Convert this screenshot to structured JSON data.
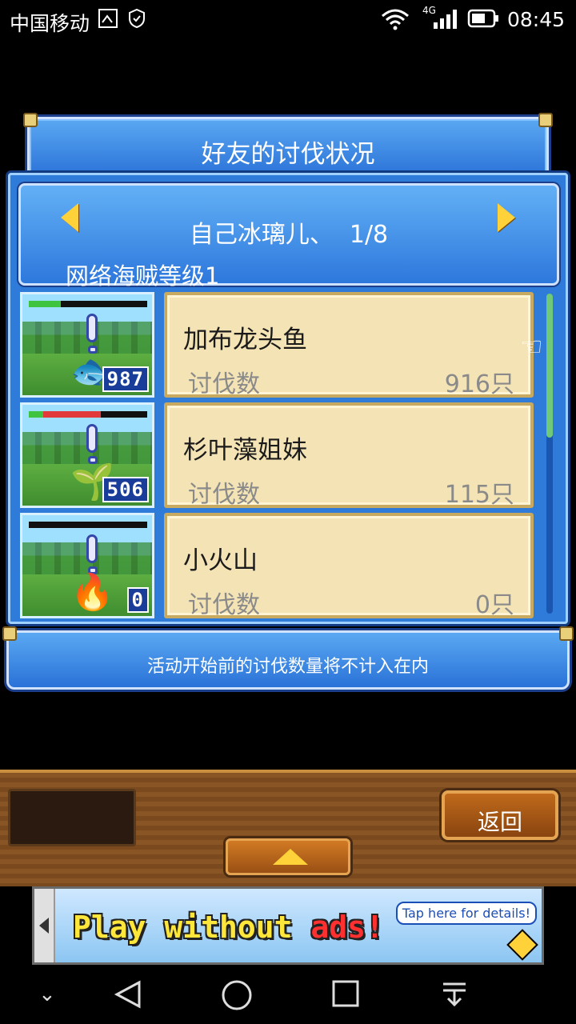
{
  "status_bar": {
    "carrier": "中国移动",
    "network": "4G",
    "time": "08:45"
  },
  "dialog": {
    "title": "好友的讨伐状况",
    "player_name": "自己冰璃儿、",
    "page": "1/8",
    "level_text": "网络海贼等级1",
    "info_text": "活动开始前的讨伐数量将不计入在内"
  },
  "monsters": [
    {
      "name": "加布龙头鱼",
      "label": "讨伐数",
      "count": "916只",
      "hp_number": "987",
      "hp_fraction": 0.3
    },
    {
      "name": "杉叶藻姐妹",
      "label": "讨伐数",
      "count": "115只",
      "hp_number": "506",
      "hp_fraction": 0.6
    },
    {
      "name": "小火山",
      "label": "讨伐数",
      "count": "0只",
      "hp_number": "0",
      "hp_fraction": 0
    }
  ],
  "toolbar": {
    "back_label": "返回"
  },
  "ad": {
    "headline_part1": "Play without ",
    "headline_part2": "ads!",
    "tap_text": "Tap here for details!"
  },
  "icons": {
    "wifi": "wifi-icon",
    "signal": "signal-icon",
    "battery": "battery-icon"
  }
}
